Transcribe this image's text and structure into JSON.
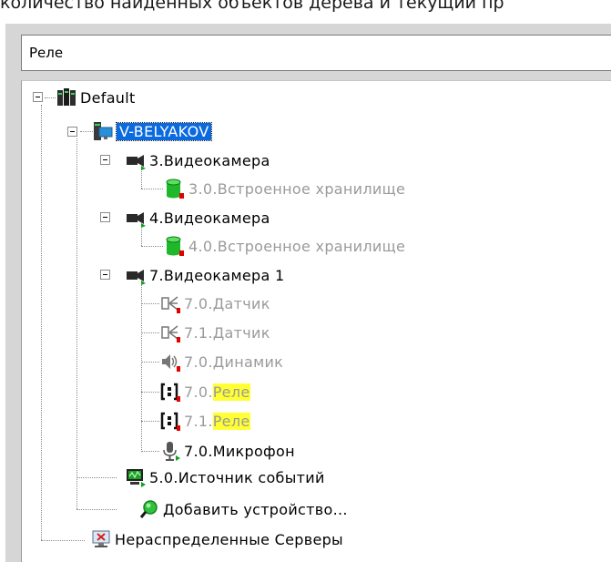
{
  "caption": "количество найденных объектов дерева и текущий пр",
  "search": {
    "value": "Реле"
  },
  "tree": {
    "root": {
      "label": "Default",
      "icon": "server-group-icon"
    },
    "server": {
      "label": "V-BELYAKOV",
      "icon": "computer-icon"
    },
    "camera3": {
      "label": "3.Видеокамера",
      "icon": "camera-icon",
      "child": {
        "label": "3.0.Встроенное хранилище",
        "icon": "storage-icon"
      }
    },
    "camera4": {
      "label": "4.Видеокамера",
      "icon": "camera-icon",
      "child": {
        "label": "4.0.Встроенное хранилище",
        "icon": "storage-icon"
      }
    },
    "camera7": {
      "label": "7.Видеокамера 1",
      "icon": "camera-icon",
      "children": [
        {
          "label": "7.0.Датчик",
          "icon": "sensor-icon"
        },
        {
          "label": "7.1.Датчик",
          "icon": "sensor-icon"
        },
        {
          "label": "7.0.Динамик",
          "icon": "speaker-icon"
        },
        {
          "prefix": "7.0.",
          "match": "Реле",
          "icon": "relay-icon"
        },
        {
          "prefix": "7.1.",
          "match": "Реле",
          "icon": "relay-icon"
        },
        {
          "label": "7.0.Микрофон",
          "icon": "microphone-icon"
        }
      ]
    },
    "event_source": {
      "label": "5.0.Источник событий",
      "icon": "event-source-icon"
    },
    "add_device": {
      "label": "Добавить устройство...",
      "icon": "add-device-icon"
    },
    "unassigned": {
      "label": "Нераспределенные Серверы",
      "icon": "unassigned-servers-icon"
    }
  },
  "colors": {
    "selection": "#0a6adf",
    "highlight": "#ffff33",
    "disabled_text": "#9a9a9a",
    "status_red": "#e00000",
    "status_green": "#10a020"
  }
}
